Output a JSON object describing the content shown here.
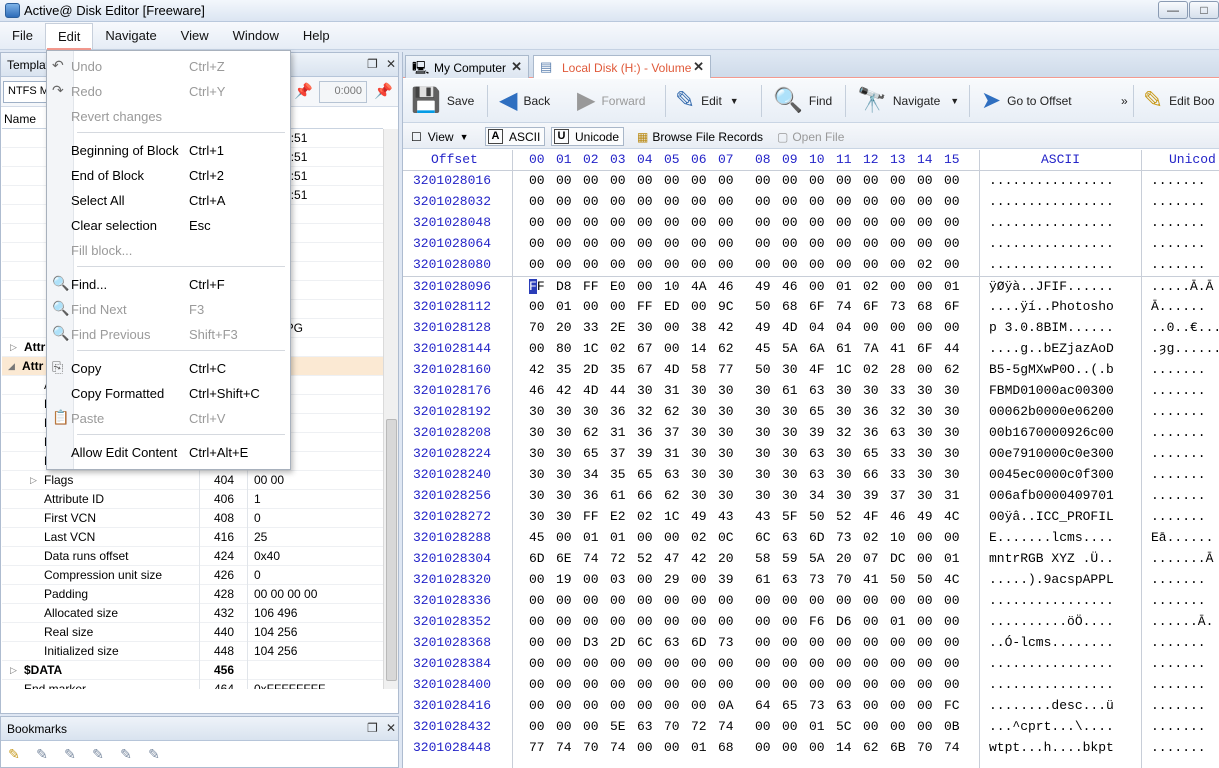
{
  "window": {
    "title": "Active@ Disk Editor [Freeware]",
    "controls": [
      "—",
      "□"
    ]
  },
  "menubar": [
    "File",
    "Edit",
    "Navigate",
    "View",
    "Window",
    "Help"
  ],
  "edit_menu": {
    "items": [
      {
        "label": "Undo",
        "shortcut": "Ctrl+Z",
        "disabled": true,
        "icon": "undo-icon"
      },
      {
        "label": "Redo",
        "shortcut": "Ctrl+Y",
        "disabled": true,
        "icon": "redo-icon"
      },
      {
        "label": "Revert changes",
        "shortcut": "",
        "disabled": true
      },
      {
        "label": "Beginning of Block",
        "shortcut": "Ctrl+1",
        "disabled": false
      },
      {
        "label": "End of Block",
        "shortcut": "Ctrl+2",
        "disabled": false
      },
      {
        "label": "Select All",
        "shortcut": "Ctrl+A",
        "disabled": false
      },
      {
        "label": "Clear selection",
        "shortcut": "Esc",
        "disabled": false
      },
      {
        "label": "Fill block...",
        "shortcut": "",
        "disabled": true
      },
      {
        "label": "Find...",
        "shortcut": "Ctrl+F",
        "disabled": false,
        "icon": "find-icon"
      },
      {
        "label": "Find Next",
        "shortcut": "F3",
        "disabled": true,
        "icon": "find-next-icon"
      },
      {
        "label": "Find Previous",
        "shortcut": "Shift+F3",
        "disabled": true,
        "icon": "find-previous-icon"
      },
      {
        "label": "Copy",
        "shortcut": "Ctrl+C",
        "disabled": false,
        "icon": "copy-icon"
      },
      {
        "label": "Copy Formatted",
        "shortcut": "Ctrl+Shift+C",
        "disabled": false
      },
      {
        "label": "Paste",
        "shortcut": "Ctrl+V",
        "disabled": true,
        "icon": "paste-icon"
      },
      {
        "label": "Allow Edit Content",
        "shortcut": "Ctrl+Alt+E",
        "disabled": false
      }
    ]
  },
  "left_panel": {
    "title": "Templat",
    "template_select": "NTFS MI",
    "numeric_field": "0:000",
    "tree_header": {
      "name": "Name"
    },
    "rows": [
      {
        "name": "",
        "offset": "",
        "value": "020 10:51",
        "bold": false
      },
      {
        "name": "",
        "offset": "",
        "value": "020 10:51",
        "bold": false
      },
      {
        "name": "",
        "offset": "",
        "value": "020 10:51",
        "bold": false
      },
      {
        "name": "",
        "offset": "",
        "value": "020 10:51",
        "bold": false
      },
      {
        "name": "",
        "offset": "",
        "value": "",
        "bold": false
      },
      {
        "name": "",
        "offset": "",
        "value": "",
        "bold": false
      },
      {
        "name": "",
        "offset": "",
        "value": "0 00",
        "bold": false
      },
      {
        "name": "",
        "offset": "",
        "value": "",
        "bold": false
      },
      {
        "name": "",
        "offset": "",
        "value": "",
        "bold": false
      },
      {
        "name": "",
        "offset": "",
        "value": "",
        "bold": false
      },
      {
        "name": "",
        "offset": "",
        "value": "D~1.JPG",
        "bold": false
      },
      {
        "name": "Attr",
        "offset": "",
        "value": "",
        "bold": true
      },
      {
        "name": "Attr",
        "offset": "",
        "value": "",
        "bold": true
      },
      {
        "name": "A",
        "offset": "",
        "value": "",
        "bold": false
      },
      {
        "name": "L",
        "offset": "",
        "value": "",
        "bold": false
      },
      {
        "name": "N",
        "offset": "",
        "value": "",
        "bold": false
      },
      {
        "name": "N",
        "offset": "",
        "value": "",
        "bold": false
      },
      {
        "name": "N",
        "offset": "",
        "value": "",
        "bold": false
      },
      {
        "name": "Flags",
        "offset": "404",
        "value": "00 00",
        "bold": false
      },
      {
        "name": "Attribute ID",
        "offset": "406",
        "value": "1",
        "bold": false
      },
      {
        "name": "First VCN",
        "offset": "408",
        "value": "0",
        "bold": false
      },
      {
        "name": "Last VCN",
        "offset": "416",
        "value": "25",
        "bold": false
      },
      {
        "name": "Data runs offset",
        "offset": "424",
        "value": "0x40",
        "bold": false
      },
      {
        "name": "Compression unit size",
        "offset": "426",
        "value": "0",
        "bold": false
      },
      {
        "name": "Padding",
        "offset": "428",
        "value": "00 00 00 00",
        "bold": false
      },
      {
        "name": "Allocated size",
        "offset": "432",
        "value": "106 496",
        "bold": false
      },
      {
        "name": "Real size",
        "offset": "440",
        "value": "104 256",
        "bold": false
      },
      {
        "name": "Initialized size",
        "offset": "448",
        "value": "104 256",
        "bold": false
      },
      {
        "name": "$DATA",
        "offset": "456",
        "value": "",
        "bold": true
      },
      {
        "name": "End marker",
        "offset": "464",
        "value": "0xFFFFFFFF",
        "bold": false
      }
    ]
  },
  "bookmarks": {
    "title": "Bookmarks"
  },
  "tabs": [
    {
      "label": "My Computer",
      "active": false
    },
    {
      "label": "Local Disk (H:) - Volume",
      "active": true
    }
  ],
  "toolbar": {
    "save": "Save",
    "back": "Back",
    "forward": "Forward",
    "edit": "Edit",
    "find": "Find",
    "navigate": "Navigate",
    "goto": "Go to Offset",
    "more": "»",
    "editboot": "Edit Boo"
  },
  "toolbar2": {
    "view": "View",
    "ascii": "ASCII",
    "unicode": "Unicode",
    "browse": "Browse File Records",
    "open": "Open File"
  },
  "hex": {
    "header": {
      "offset": "Offset",
      "cols": [
        "00",
        "01",
        "02",
        "03",
        "04",
        "05",
        "06",
        "07",
        "08",
        "09",
        "10",
        "11",
        "12",
        "13",
        "14",
        "15"
      ],
      "ascii": "ASCII",
      "unicode": "Unicod"
    },
    "rows": [
      {
        "offset": "3201028016",
        "bytes": "00 00 00 00 00 00 00 00 00 00 00 00 00 00 00 00",
        "ascii": "................",
        "unicode": "......."
      },
      {
        "offset": "3201028032",
        "bytes": "00 00 00 00 00 00 00 00 00 00 00 00 00 00 00 00",
        "ascii": "................",
        "unicode": "......."
      },
      {
        "offset": "3201028048",
        "bytes": "00 00 00 00 00 00 00 00 00 00 00 00 00 00 00 00",
        "ascii": "................",
        "unicode": "......."
      },
      {
        "offset": "3201028064",
        "bytes": "00 00 00 00 00 00 00 00 00 00 00 00 00 00 00 00",
        "ascii": "................",
        "unicode": "......."
      },
      {
        "offset": "3201028080",
        "bytes": "00 00 00 00 00 00 00 00 00 00 00 00 00 00 02 00",
        "ascii": "................",
        "unicode": "......."
      },
      {
        "offset": "3201028096",
        "bytes": "FF D8 FF E0 00 10 4A 46 49 46 00 01 02 00 00 01",
        "ascii": "ÿØÿà..JFIF......",
        "unicode": ".....Ā.Ā"
      },
      {
        "offset": "3201028112",
        "bytes": "00 01 00 00 FF ED 00 9C 50 68 6F 74 6F 73 68 6F",
        "ascii": "....ÿí..Photosho",
        "unicode": "Ā......"
      },
      {
        "offset": "3201028128",
        "bytes": "70 20 33 2E 30 00 38 42 49 4D 04 04 00 00 00 00",
        "ascii": "p 3.0.8BIM......",
        "unicode": "..0..€...."
      },
      {
        "offset": "3201028144",
        "bytes": "00 80 1C 02 67 00 14 62 45 5A 6A 61 7A 41 6F 44",
        "ascii": "....g..bEZjazAoD",
        "unicode": ".ȝg......"
      },
      {
        "offset": "3201028160",
        "bytes": "42 35 2D 35 67 4D 58 77 50 30 4F 1C 02 28 00 62",
        "ascii": "B5-5gMXwP0O..(.b",
        "unicode": "......."
      },
      {
        "offset": "3201028176",
        "bytes": "46 42 4D 44 30 31 30 30 30 61 63 30 30 33 30 30",
        "ascii": "FBMD01000ac00300",
        "unicode": "......."
      },
      {
        "offset": "3201028192",
        "bytes": "30 30 30 36 32 62 30 30 30 30 65 30 36 32 30 30",
        "ascii": "00062b0000e06200",
        "unicode": "......."
      },
      {
        "offset": "3201028208",
        "bytes": "30 30 62 31 36 37 30 30 30 30 39 32 36 63 30 30",
        "ascii": "00b1670000926c00",
        "unicode": "......."
      },
      {
        "offset": "3201028224",
        "bytes": "30 30 65 37 39 31 30 30 30 30 63 30 65 33 30 30",
        "ascii": "00e7910000c0e300",
        "unicode": "......."
      },
      {
        "offset": "3201028240",
        "bytes": "30 30 34 35 65 63 30 30 30 30 63 30 66 33 30 30",
        "ascii": "0045ec0000c0f300",
        "unicode": "......."
      },
      {
        "offset": "3201028256",
        "bytes": "30 30 36 61 66 62 30 30 30 30 34 30 39 37 30 31",
        "ascii": "006afb0000409701",
        "unicode": "......."
      },
      {
        "offset": "3201028272",
        "bytes": "30 30 FF E2 02 1C 49 43 43 5F 50 52 4F 46 49 4C",
        "ascii": "00ÿâ..ICC_PROFIL",
        "unicode": "......."
      },
      {
        "offset": "3201028288",
        "bytes": "45 00 01 01 00 00 02 0C 6C 63 6D 73 02 10 00 00",
        "ascii": "E.......lcms....",
        "unicode": "Eā......"
      },
      {
        "offset": "3201028304",
        "bytes": "6D 6E 74 72 52 47 42 20 58 59 5A 20 07 DC 00 01",
        "ascii": "mntrRGB XYZ .Ü..",
        "unicode": ".......Ā"
      },
      {
        "offset": "3201028320",
        "bytes": "00 19 00 03 00 29 00 39 61 63 73 70 41 50 50 4C",
        "ascii": ".....).9acspAPPL",
        "unicode": "......."
      },
      {
        "offset": "3201028336",
        "bytes": "00 00 00 00 00 00 00 00 00 00 00 00 00 00 00 00",
        "ascii": "................",
        "unicode": "......."
      },
      {
        "offset": "3201028352",
        "bytes": "00 00 00 00 00 00 00 00 00 00 F6 D6 00 01 00 00",
        "ascii": "..........öÖ....",
        "unicode": "......Ā."
      },
      {
        "offset": "3201028368",
        "bytes": "00 00 D3 2D 6C 63 6D 73 00 00 00 00 00 00 00 00",
        "ascii": "..Ó-lcms........",
        "unicode": "......."
      },
      {
        "offset": "3201028384",
        "bytes": "00 00 00 00 00 00 00 00 00 00 00 00 00 00 00 00",
        "ascii": "................",
        "unicode": "......."
      },
      {
        "offset": "3201028400",
        "bytes": "00 00 00 00 00 00 00 00 00 00 00 00 00 00 00 00",
        "ascii": "................",
        "unicode": "......."
      },
      {
        "offset": "3201028416",
        "bytes": "00 00 00 00 00 00 00 0A 64 65 73 63 00 00 00 FC",
        "ascii": "........desc...ü",
        "unicode": "......."
      },
      {
        "offset": "3201028432",
        "bytes": "00 00 00 5E 63 70 72 74 00 00 01 5C 00 00 00 0B",
        "ascii": "...^cprt...\\....",
        "unicode": "......."
      },
      {
        "offset": "3201028448",
        "bytes": "77 74 70 74 00 00 01 68 00 00 00 14 62 6B 70 74",
        "ascii": "wtpt...h....bkpt",
        "unicode": "......."
      }
    ]
  }
}
